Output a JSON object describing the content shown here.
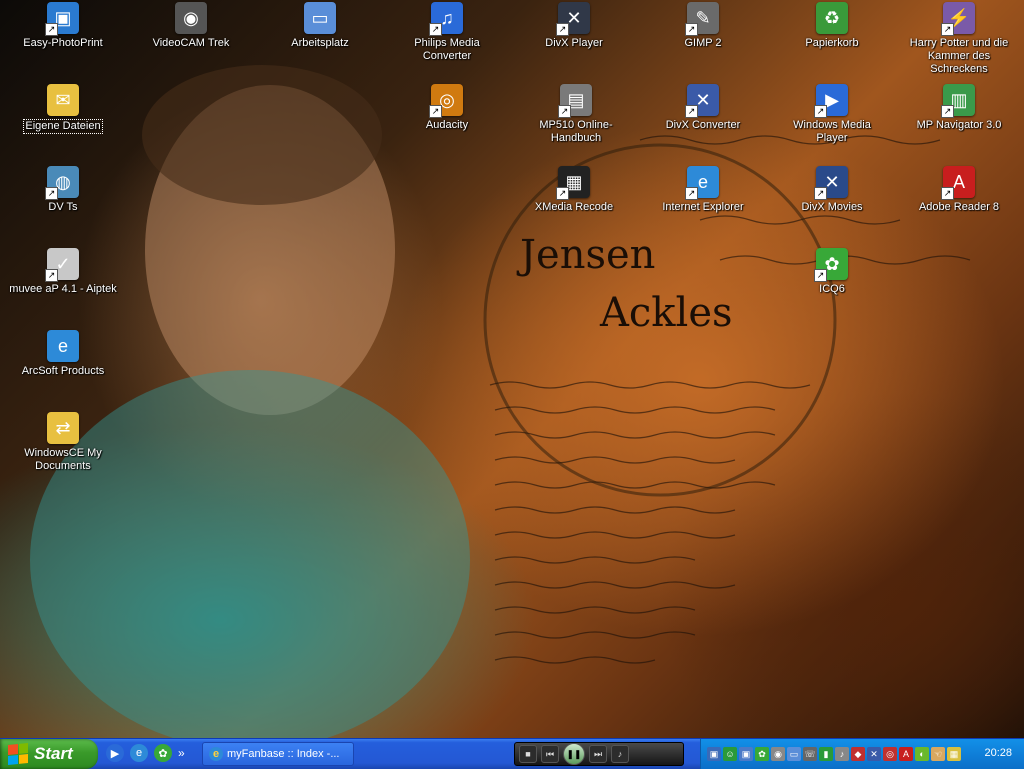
{
  "desktop": {
    "icons": [
      {
        "label": "Easy-PhotoPrint",
        "icon": "photo-print-icon",
        "glyph": "▣",
        "color": "#2a7ad0",
        "shortcut": true
      },
      {
        "label": "VideoCAM Trek",
        "icon": "webcam-icon",
        "glyph": "◉",
        "color": "#555555",
        "shortcut": false
      },
      {
        "label": "Arbeitsplatz",
        "icon": "my-computer-icon",
        "glyph": "▭",
        "color": "#5a8ed8",
        "shortcut": false
      },
      {
        "label": "Philips Media Converter",
        "icon": "media-converter-icon",
        "glyph": "♫",
        "color": "#2a6ad8",
        "shortcut": true
      },
      {
        "label": "DivX Player",
        "icon": "divx-player-icon",
        "glyph": "✕",
        "color": "#303848",
        "shortcut": true
      },
      {
        "label": "GIMP 2",
        "icon": "gimp-icon",
        "glyph": "✎",
        "color": "#6a6a6a",
        "shortcut": true
      },
      {
        "label": "Papierkorb",
        "icon": "recycle-bin-icon",
        "glyph": "♻",
        "color": "#3a9a3a",
        "shortcut": false
      },
      {
        "label": "Harry Potter und die Kammer des Schreckens",
        "icon": "game-icon",
        "glyph": "⚡",
        "color": "#7a5aa8",
        "shortcut": true
      },
      {
        "label": "Eigene Dateien",
        "icon": "my-documents-icon",
        "glyph": "✉",
        "color": "#e8c040",
        "shortcut": false,
        "selected": true
      },
      {
        "label": "Audacity",
        "icon": "audacity-icon",
        "glyph": "◎",
        "color": "#d07a10",
        "shortcut": true
      },
      {
        "label": "MP510 Online-Handbuch",
        "icon": "printer-manual-icon",
        "glyph": "▤",
        "color": "#7a7a7a",
        "shortcut": true
      },
      {
        "label": "DivX Converter",
        "icon": "divx-converter-icon",
        "glyph": "✕",
        "color": "#3a5aa8",
        "shortcut": true
      },
      {
        "label": "Windows Media Player",
        "icon": "media-player-icon",
        "glyph": "▶",
        "color": "#2a6ad8",
        "shortcut": true
      },
      {
        "label": "MP Navigator 3.0",
        "icon": "scanner-icon",
        "glyph": "▥",
        "color": "#3a9a4a",
        "shortcut": true
      },
      {
        "label": "DV Ts",
        "icon": "camcorder-icon",
        "glyph": "◍",
        "color": "#4a8ab8",
        "shortcut": true
      },
      {
        "label": "XMedia Recode",
        "icon": "film-icon",
        "glyph": "▦",
        "color": "#222222",
        "shortcut": true
      },
      {
        "label": "Internet Explorer",
        "icon": "internet-explorer-icon",
        "glyph": "e",
        "color": "#2d8ad8",
        "shortcut": true
      },
      {
        "label": "DivX Movies",
        "icon": "divx-movies-icon",
        "glyph": "✕",
        "color": "#2a4a8a",
        "shortcut": true
      },
      {
        "label": "Adobe Reader 8",
        "icon": "pdf-icon",
        "glyph": "A",
        "color": "#c81e1e",
        "shortcut": true
      },
      {
        "label": "muvee aP 4.1 - Aiptek",
        "icon": "muvee-icon",
        "glyph": "✓",
        "color": "#c8c8c8",
        "shortcut": true
      },
      {
        "label": "ICQ6",
        "icon": "icq-icon",
        "glyph": "✿",
        "color": "#38a838",
        "shortcut": true
      },
      {
        "label": "ArcSoft Products",
        "icon": "internet-explorer-icon",
        "glyph": "e",
        "color": "#2d8ad8",
        "shortcut": false
      },
      {
        "label": "WindowsCE My Documents",
        "icon": "sync-folder-icon",
        "glyph": "⇄",
        "color": "#e8c040",
        "shortcut": false
      }
    ]
  },
  "wallpaper": {
    "line1": "Jensen",
    "line2": "Ackles"
  },
  "taskbar": {
    "start_label": "Start",
    "quicklaunch": [
      {
        "icon": "media-player-icon",
        "glyph": "▶",
        "color": "#2a6ad8"
      },
      {
        "icon": "internet-explorer-icon",
        "glyph": "e",
        "color": "#2d8ad8"
      },
      {
        "icon": "icq-icon",
        "glyph": "✿",
        "color": "#38a838"
      }
    ],
    "quicklaunch_more": "»",
    "task_label": "myFanbase :: Index -...",
    "media_bar": {
      "buttons": [
        {
          "icon": "stop-icon",
          "glyph": "■"
        },
        {
          "icon": "previous-icon",
          "glyph": "⏮"
        },
        {
          "icon": "play-pause-icon",
          "glyph": "❚❚"
        },
        {
          "icon": "next-icon",
          "glyph": "⏭"
        },
        {
          "icon": "volume-icon",
          "glyph": "♪"
        }
      ]
    },
    "tray_icons": [
      {
        "icon": "network-icon",
        "glyph": "▣",
        "color": "#3a6ab8"
      },
      {
        "icon": "messenger-icon",
        "glyph": "☺",
        "color": "#2a9a3a"
      },
      {
        "icon": "network-icon-2",
        "glyph": "▣",
        "color": "#4a7ac8"
      },
      {
        "icon": "icq-tray-icon",
        "glyph": "✿",
        "color": "#38a838"
      },
      {
        "icon": "disc-icon",
        "glyph": "◉",
        "color": "#888888"
      },
      {
        "icon": "monitor-icon",
        "glyph": "▭",
        "color": "#5a8ed8"
      },
      {
        "icon": "phone-icon",
        "glyph": "☏",
        "color": "#666666"
      },
      {
        "icon": "signal-icon",
        "glyph": "▮",
        "color": "#2a9a3a"
      },
      {
        "icon": "speaker-icon",
        "glyph": "♪",
        "color": "#888888"
      },
      {
        "icon": "shield-icon",
        "glyph": "◆",
        "color": "#c03030"
      },
      {
        "icon": "security-icon",
        "glyph": "✕",
        "color": "#3a5aa8"
      },
      {
        "icon": "antivirus-icon",
        "glyph": "◎",
        "color": "#c03030"
      },
      {
        "icon": "acrobat-icon",
        "glyph": "A",
        "color": "#c81e1e"
      },
      {
        "icon": "nvidia-icon",
        "glyph": "◐",
        "color": "#6ab82a"
      },
      {
        "icon": "hand-icon",
        "glyph": "☜",
        "color": "#d8a860"
      },
      {
        "icon": "app-icon",
        "glyph": "▦",
        "color": "#d8c040"
      }
    ],
    "clock": "20:28"
  }
}
